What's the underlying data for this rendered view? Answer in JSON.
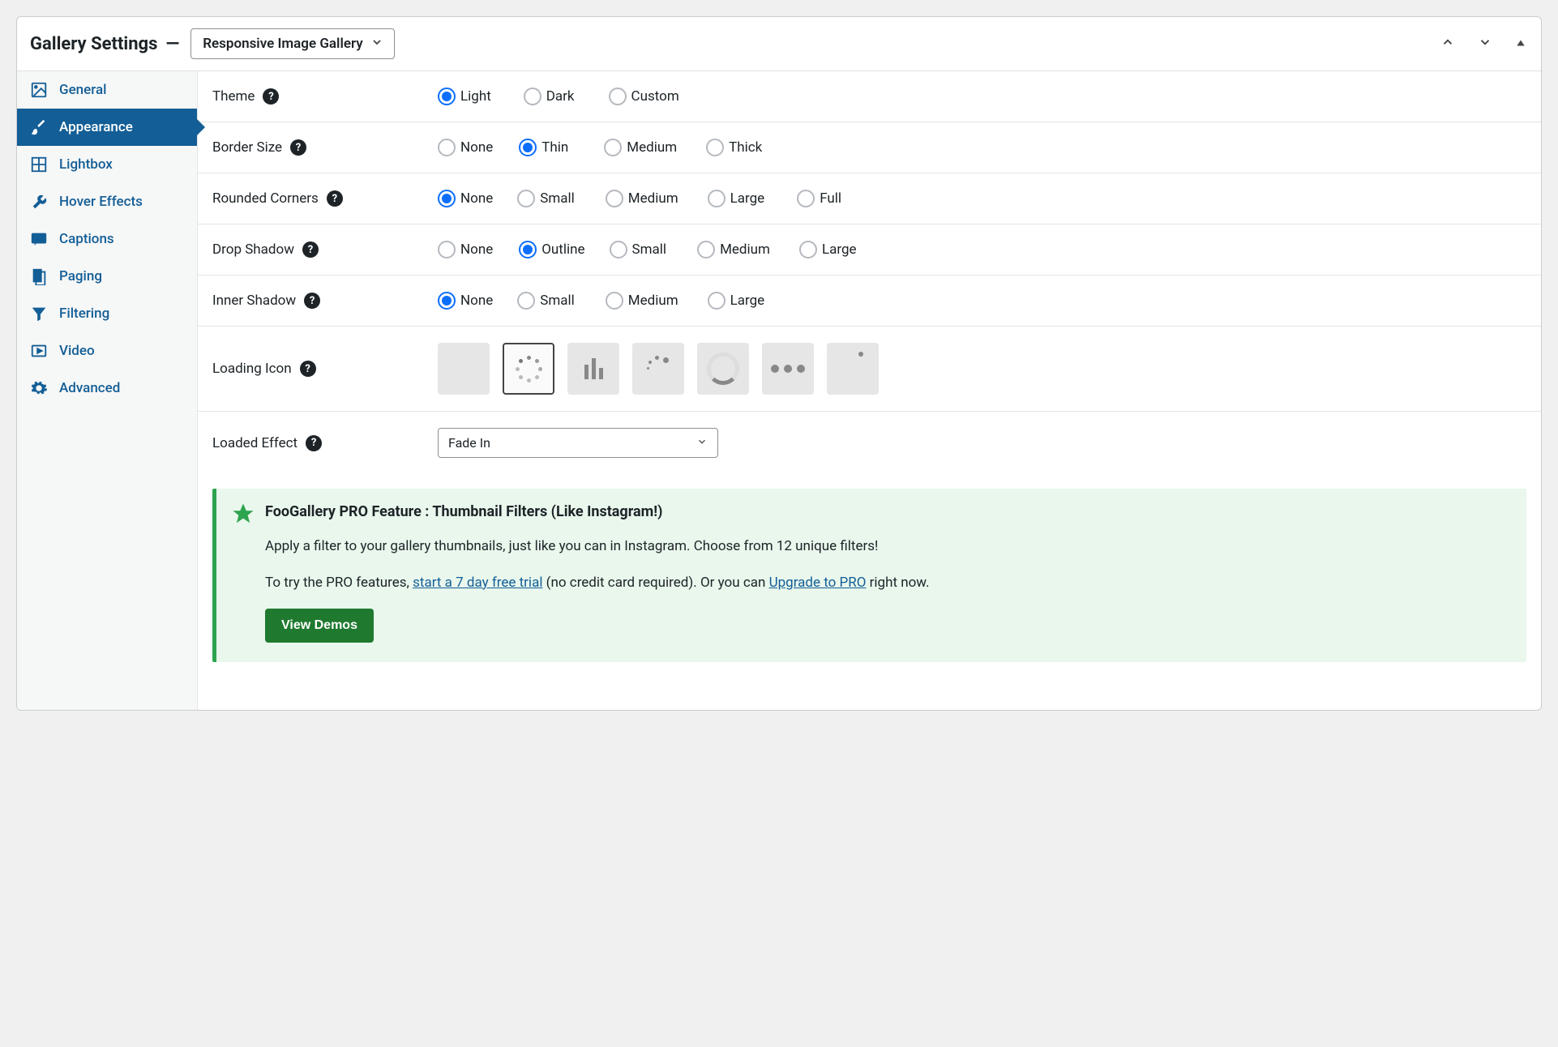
{
  "header": {
    "title": "Gallery Settings",
    "preset": "Responsive Image Gallery"
  },
  "sidebar": {
    "general": "General",
    "appearance": "Appearance",
    "lightbox": "Lightbox",
    "hover": "Hover Effects",
    "captions": "Captions",
    "paging": "Paging",
    "filtering": "Filtering",
    "video": "Video",
    "advanced": "Advanced"
  },
  "rows": {
    "theme": {
      "label": "Theme",
      "opts": {
        "light": "Light",
        "dark": "Dark",
        "custom": "Custom"
      },
      "selected": "light"
    },
    "border": {
      "label": "Border Size",
      "opts": {
        "none": "None",
        "thin": "Thin",
        "medium": "Medium",
        "thick": "Thick"
      },
      "selected": "thin"
    },
    "rounded": {
      "label": "Rounded Corners",
      "opts": {
        "none": "None",
        "small": "Small",
        "medium": "Medium",
        "large": "Large",
        "full": "Full"
      },
      "selected": "none"
    },
    "drop": {
      "label": "Drop Shadow",
      "opts": {
        "none": "None",
        "outline": "Outline",
        "small": "Small",
        "medium": "Medium",
        "large": "Large"
      },
      "selected": "outline"
    },
    "inner": {
      "label": "Inner Shadow",
      "opts": {
        "none": "None",
        "small": "Small",
        "medium": "Medium",
        "large": "Large"
      },
      "selected": "none"
    },
    "loading": {
      "label": "Loading Icon"
    },
    "loaded": {
      "label": "Loaded Effect",
      "value": "Fade In"
    }
  },
  "promo": {
    "title": "FooGallery PRO Feature : Thumbnail Filters (Like Instagram!)",
    "p1": "Apply a filter to your gallery thumbnails, just like you can in Instagram. Choose from 12 unique filters!",
    "p2a": "To try the PRO features, ",
    "link1": "start a 7 day free trial",
    "p2b": " (no credit card required). Or you can ",
    "link2": "Upgrade to PRO",
    "p2c": " right now.",
    "button": "View Demos"
  }
}
